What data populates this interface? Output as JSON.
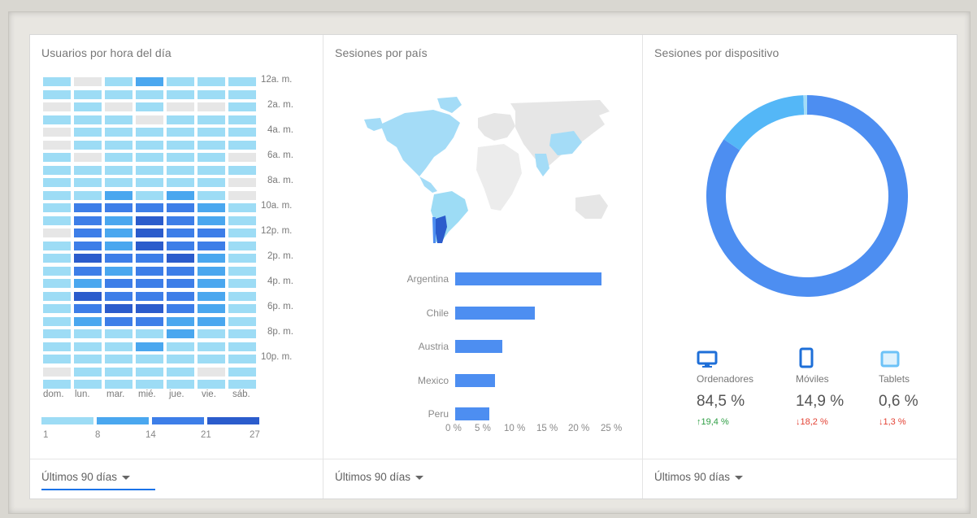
{
  "cards": {
    "users_by_hour": {
      "title": "Usuarios por hora del día",
      "hour_labels": [
        "12a. m.",
        "2a. m.",
        "4a. m.",
        "6a. m.",
        "8a. m.",
        "10a. m.",
        "12p. m.",
        "2p. m.",
        "4p. m.",
        "6p. m.",
        "8p. m.",
        "10p. m."
      ],
      "day_labels": [
        "dom.",
        "lun.",
        "mar.",
        "mié.",
        "jue.",
        "vie.",
        "sáb."
      ],
      "legend_values": [
        "1",
        "8",
        "14",
        "21",
        "27"
      ],
      "legend_colors": [
        "#9ddcf5",
        "#4aa7ef",
        "#3d7ee8",
        "#2b5ccc"
      ],
      "empty_color": "#e6e6e6",
      "levels": [
        [
          1,
          0,
          1,
          2,
          1,
          1,
          1
        ],
        [
          1,
          1,
          1,
          1,
          1,
          1,
          1
        ],
        [
          0,
          1,
          0,
          1,
          0,
          0,
          1
        ],
        [
          1,
          1,
          1,
          0,
          1,
          1,
          1
        ],
        [
          0,
          1,
          1,
          1,
          1,
          1,
          1
        ],
        [
          0,
          1,
          1,
          1,
          1,
          1,
          1
        ],
        [
          1,
          0,
          1,
          1,
          1,
          1,
          0
        ],
        [
          1,
          1,
          1,
          1,
          1,
          1,
          1
        ],
        [
          1,
          1,
          1,
          1,
          1,
          1,
          0
        ],
        [
          1,
          1,
          2,
          1,
          2,
          1,
          0
        ],
        [
          1,
          3,
          3,
          3,
          3,
          2,
          1
        ],
        [
          1,
          3,
          2,
          4,
          3,
          2,
          1
        ],
        [
          0,
          3,
          2,
          4,
          3,
          3,
          1
        ],
        [
          1,
          3,
          2,
          4,
          3,
          3,
          1
        ],
        [
          1,
          4,
          3,
          3,
          4,
          2,
          1
        ],
        [
          1,
          3,
          2,
          3,
          3,
          2,
          1
        ],
        [
          1,
          2,
          3,
          3,
          3,
          2,
          1
        ],
        [
          1,
          4,
          3,
          3,
          3,
          2,
          1
        ],
        [
          1,
          3,
          4,
          4,
          3,
          2,
          1
        ],
        [
          1,
          2,
          3,
          3,
          2,
          2,
          1
        ],
        [
          1,
          1,
          1,
          1,
          2,
          1,
          1
        ],
        [
          1,
          1,
          1,
          2,
          1,
          1,
          1
        ],
        [
          1,
          1,
          1,
          1,
          1,
          1,
          1
        ],
        [
          0,
          1,
          1,
          1,
          1,
          0,
          1
        ],
        [
          1,
          1,
          1,
          1,
          1,
          1,
          1
        ]
      ],
      "range": "Últimos 90 días"
    },
    "sessions_by_country": {
      "title": "Sesiones por país",
      "range": "Últimos 90 días",
      "chart_data": {
        "type": "bar",
        "categories": [
          "Argentina",
          "Chile",
          "Austria",
          "Mexico",
          "Peru"
        ],
        "values": [
          22.5,
          12.3,
          7.3,
          6.1,
          5.2
        ],
        "xlim": [
          0,
          25
        ],
        "xticks": [
          "0 %",
          "5 %",
          "10 %",
          "15 %",
          "20 %",
          "25 %"
        ],
        "color": "#4d8ef1"
      }
    },
    "sessions_by_device": {
      "title": "Sesiones por dispositivo",
      "range": "Últimos 90 días",
      "chart_data": {
        "type": "pie",
        "categories": [
          "Ordenadores",
          "Móviles",
          "Tablets"
        ],
        "values": [
          84.5,
          14.9,
          0.6
        ],
        "colors": [
          "#4d8ef1",
          "#54b7f7",
          "#a4dcf7"
        ]
      },
      "devices": [
        {
          "name": "Ordenadores",
          "pct": "84,5 %",
          "change": "19,4 %",
          "direction": "up",
          "icon": "desktop-icon"
        },
        {
          "name": "Móviles",
          "pct": "14,9 %",
          "change": "18,2 %",
          "direction": "down",
          "icon": "mobile-icon"
        },
        {
          "name": "Tablets",
          "pct": "0,6 %",
          "change": "1,3 %",
          "direction": "down",
          "icon": "tablet-icon"
        }
      ]
    }
  }
}
